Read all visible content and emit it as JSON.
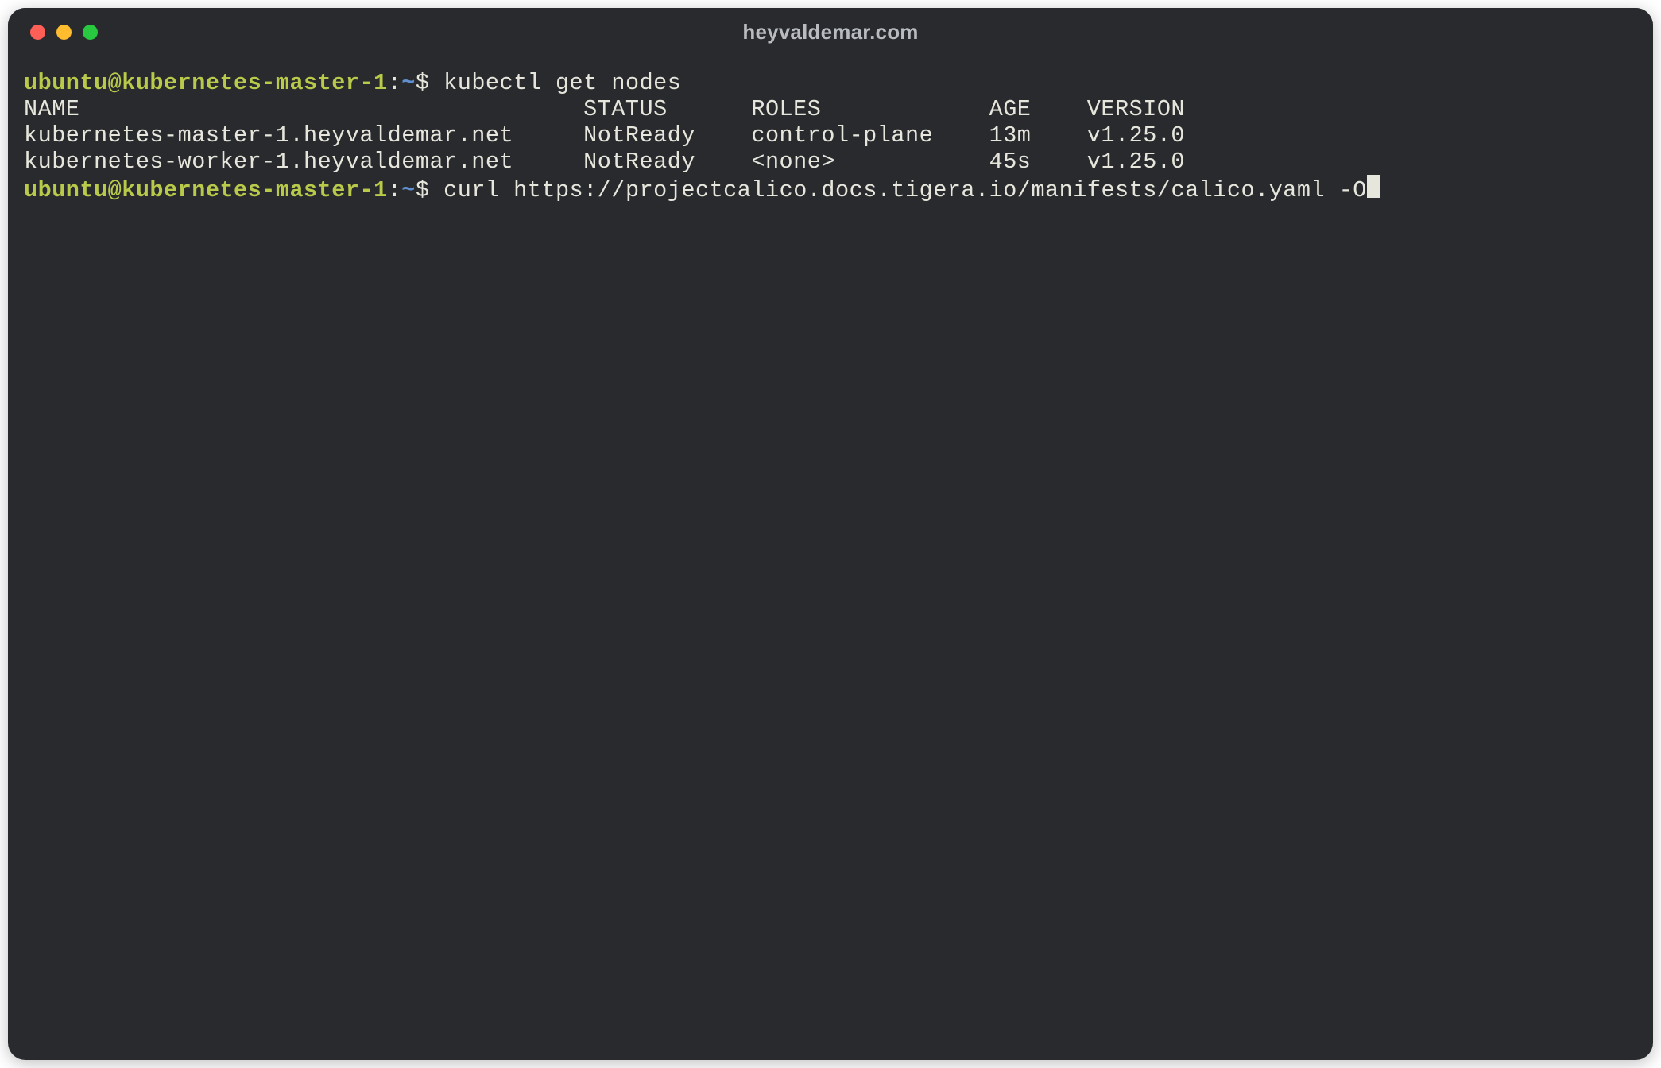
{
  "window": {
    "title": "heyvaldemar.com"
  },
  "prompt": {
    "user_host": "ubuntu@kubernetes-master-1",
    "separator": ":",
    "path": "~",
    "sigil": "$"
  },
  "session": {
    "cmd1": "kubectl get nodes",
    "table": {
      "headers": {
        "name": "NAME",
        "status": "STATUS",
        "roles": "ROLES",
        "age": "AGE",
        "version": "VERSION"
      },
      "rows": [
        {
          "name": "kubernetes-master-1.heyvaldemar.net",
          "status": "NotReady",
          "roles": "control-plane",
          "age": "13m",
          "version": "v1.25.0"
        },
        {
          "name": "kubernetes-worker-1.heyvaldemar.net",
          "status": "NotReady",
          "roles": "<none>",
          "age": "45s",
          "version": "v1.25.0"
        }
      ]
    },
    "cmd2": "curl https://projectcalico.docs.tigera.io/manifests/calico.yaml -O"
  }
}
